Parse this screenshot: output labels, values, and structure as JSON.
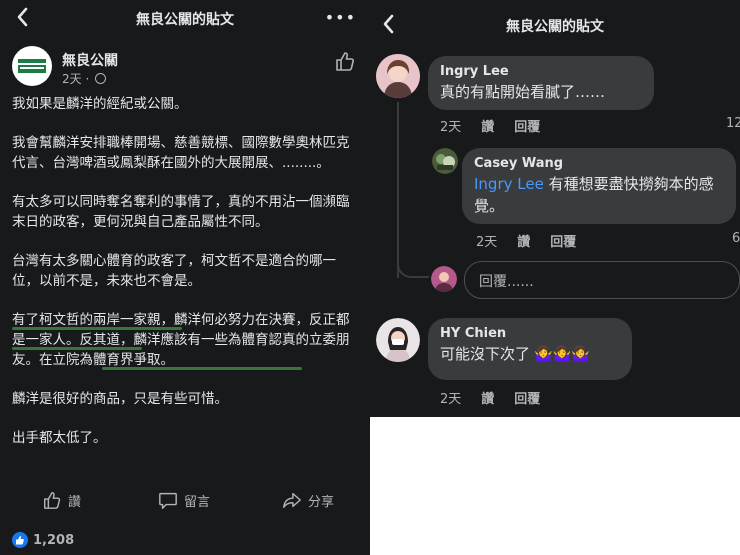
{
  "left": {
    "title": "無良公關的貼文",
    "page_name": "無良公關",
    "post_time": "2天 ·",
    "paragraphs": [
      "我如果是麟洋的經紀或公關。",
      "我會幫麟洋安排職棒開場、慈善競標、國際數學奧林匹克代言、台灣啤酒或鳳梨酥在國外的大展開展、........。",
      "有太多可以同時奪名奪利的事情了，真的不用沾一個瀕臨末日的政客，更何況與自己產品屬性不同。",
      "台灣有太多關心體育的政客了，柯文哲不是適合的哪一位，以前不是，未來也不會是。",
      "有了柯文哲的兩岸一家親，麟洋何必努力在決賽，反正都是一家人。反其道，麟洋應該有一些為體育認真的立委朋友。在立院為體育界爭取。",
      "麟洋是很好的商品，只是有些可惜。",
      "出手都太低了。"
    ],
    "actions": {
      "like": "讚",
      "comment": "留言",
      "share": "分享"
    },
    "reaction_count": "1,208"
  },
  "right": {
    "title": "無良公關的貼文",
    "comments": [
      {
        "name": "Ingry Lee",
        "text": "真的有點開始看膩了……",
        "time": "2天",
        "like": "讚",
        "reply": "回覆",
        "edge": "12"
      },
      {
        "name": "Casey Wang",
        "mention": "Ingry Lee",
        "text": " 有種想要盡快撈夠本的感覺。",
        "time": "2天",
        "like": "讚",
        "reply": "回覆",
        "edge": "6"
      },
      {
        "name": "HY Chien",
        "text": "可能沒下次了",
        "emoji": "🤷‍♀️🤷‍♀️🤷‍♀️",
        "time": "2天",
        "like": "讚",
        "reply": "回覆"
      }
    ],
    "reply_placeholder": "回覆......"
  }
}
